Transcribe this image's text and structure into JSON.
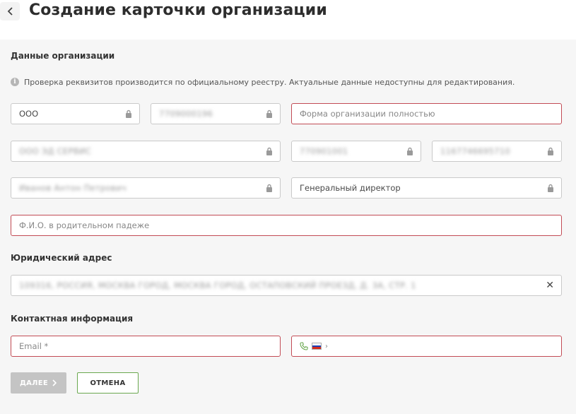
{
  "header": {
    "title": "Создание карточки организации"
  },
  "org_section": {
    "title": "Данные организации",
    "info": "Проверка реквизитов производится по официальному реестру. Актуальные данные недоступны для редактирования.",
    "fields": {
      "org_form_short": "ООО",
      "inn": "7709000196",
      "org_form_full_placeholder": "Форма организации полностью",
      "org_name": "ООО ЭД СЕРВИС",
      "kpp": "770901001",
      "ogrn": "1167746695710",
      "director_name": "Иванов Антон Петрович",
      "director_position": "Генеральный директор",
      "director_genitive_placeholder": "Ф.И.О. в родительном падеже"
    }
  },
  "address_section": {
    "title": "Юридический адрес",
    "address": "109316, РОССИЯ, МОСКВА ГОРОД, МОСКВА ГОРОД, ОСТАПОВСКИЙ ПРОЕЗД, Д. 3А, СТР. 1"
  },
  "contact_section": {
    "title": "Контактная информация",
    "email_placeholder": "Email *"
  },
  "buttons": {
    "next": "ДАЛЕЕ",
    "cancel": "ОТМЕНА"
  },
  "colors": {
    "required_border": "#c24b55",
    "accent_green": "#6aa84f",
    "disabled_button": "#c4c4c4"
  }
}
